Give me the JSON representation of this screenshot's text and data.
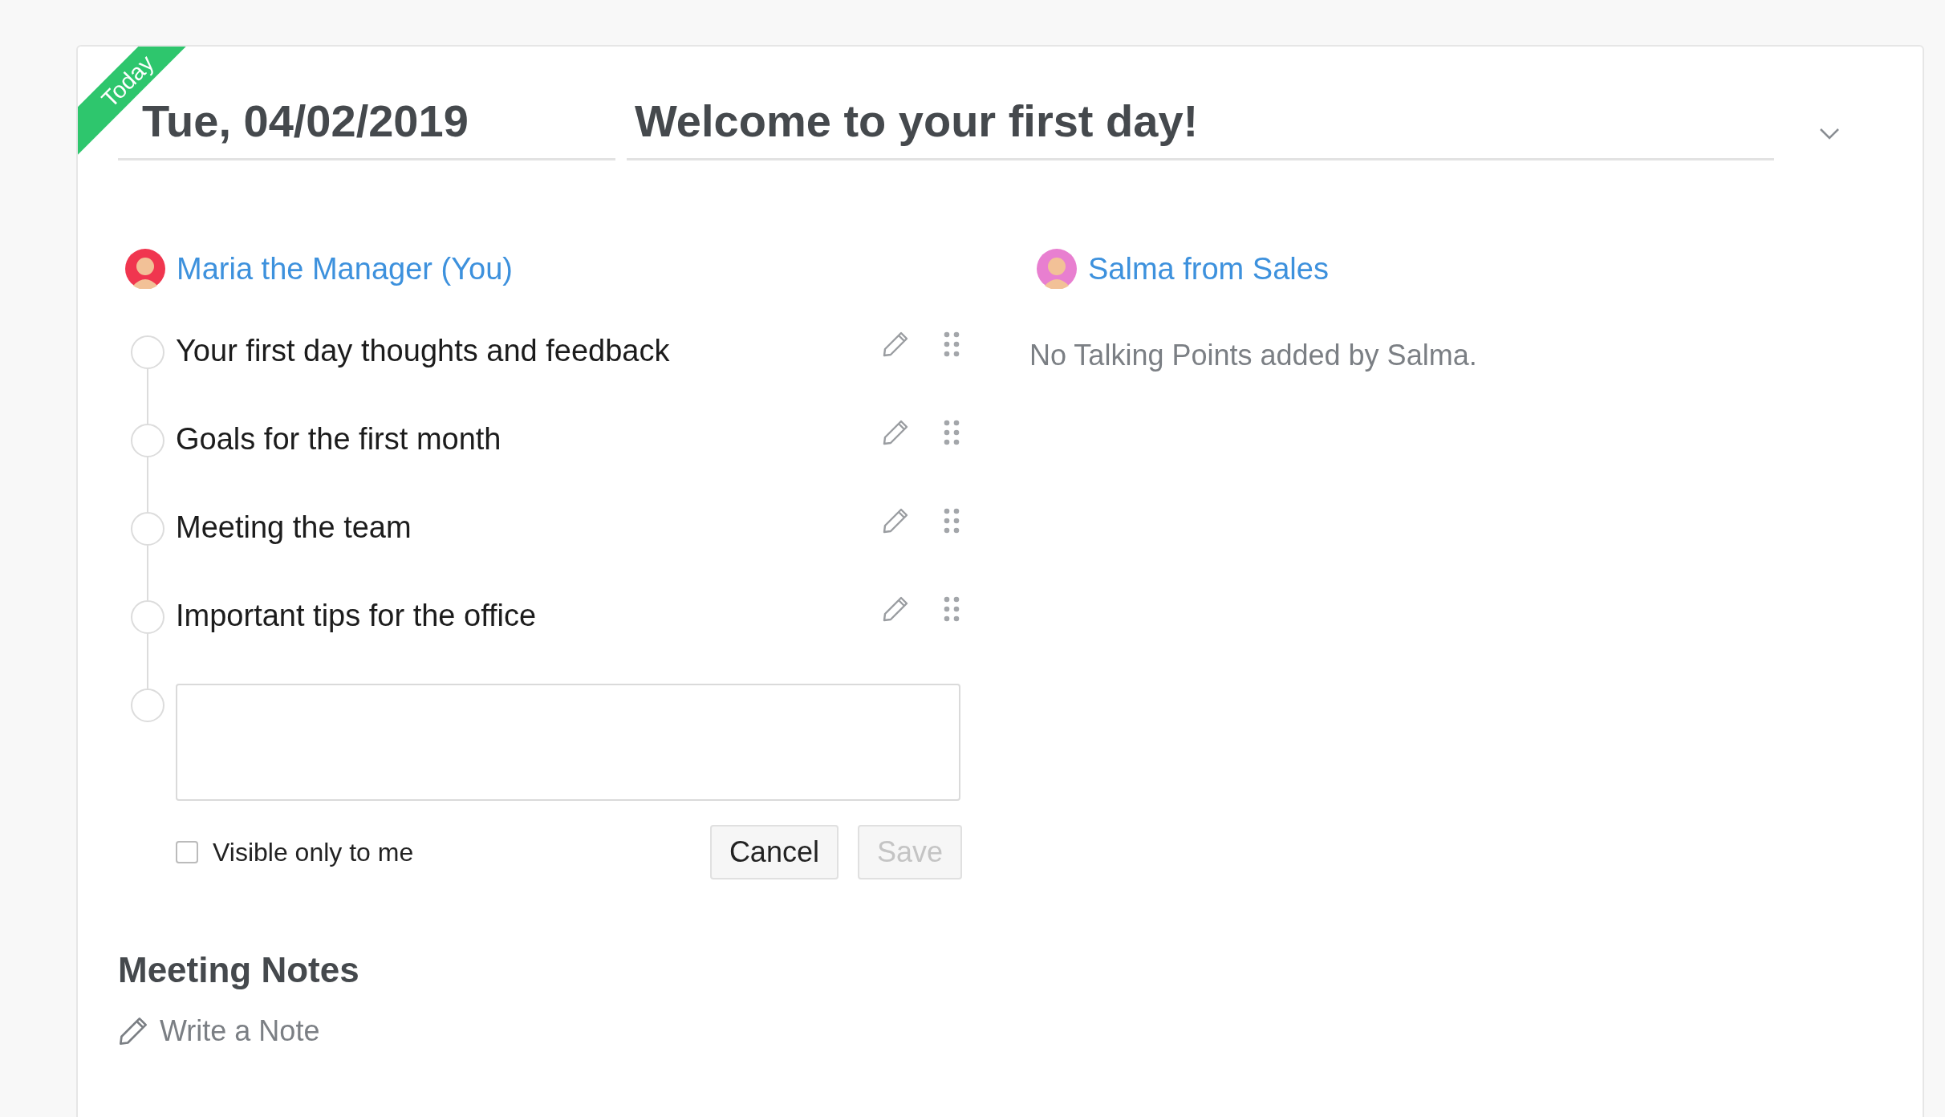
{
  "ribbon": "Today",
  "date": "Tue, 04/02/2019",
  "meeting_title": "Welcome to your first day!",
  "expanded": false,
  "participants": [
    {
      "name": "Maria the Manager (You)",
      "color": "#f0364f",
      "talking_points": [
        {
          "text": "Your first day thoughts and feedback",
          "checked": false
        },
        {
          "text": "Goals for the first month",
          "checked": false
        },
        {
          "text": "Meeting the team",
          "checked": false
        },
        {
          "text": "Important tips for the office",
          "checked": false
        }
      ],
      "new_point": {
        "visible_only_to_me": {
          "label": "Visible only to me",
          "checked": false
        },
        "buttons": [
          {
            "label": "Cancel",
            "disabled": false
          },
          {
            "label": "Save",
            "disabled": true
          }
        ]
      }
    },
    {
      "name": "Salma from Sales",
      "color": "#e87fd0",
      "empty_message": "No Talking Points added by Salma."
    }
  ],
  "notes": {
    "heading": "Meeting Notes",
    "action": "Write a Note"
  }
}
